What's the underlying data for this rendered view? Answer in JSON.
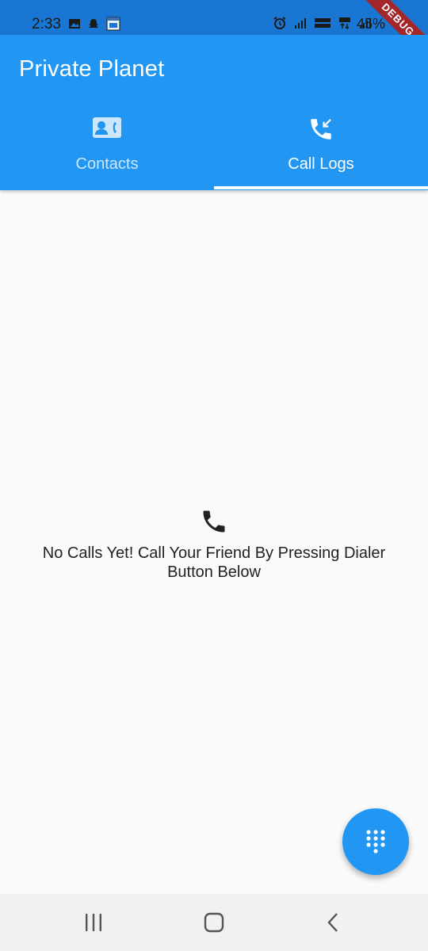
{
  "status_bar": {
    "time": "2:33",
    "battery": "45%",
    "left_icons": [
      "image-icon",
      "snapchat-icon",
      "calendar-icon"
    ],
    "right_icons": [
      "alarm-icon",
      "signal-icon",
      "volte-icon",
      "4g-icon",
      "signal-icon-2"
    ]
  },
  "debug_banner": "DEBUG",
  "app_bar": {
    "title": "Private Planet"
  },
  "tabs": [
    {
      "label": "Contacts",
      "icon": "contact-card-icon",
      "selected": false
    },
    {
      "label": "Call Logs",
      "icon": "call-received-icon",
      "selected": true
    }
  ],
  "empty_state": {
    "icon": "phone-icon",
    "message": "No Calls Yet! Call Your Friend By Pressing Dialer Button Below"
  },
  "fab": {
    "icon": "dialpad-icon"
  },
  "nav_bar": {
    "buttons": [
      "recents-icon",
      "home-icon",
      "back-icon"
    ]
  },
  "colors": {
    "primary": "#2196f3",
    "status_bar": "#1976d2",
    "debug": "#a3262a"
  }
}
